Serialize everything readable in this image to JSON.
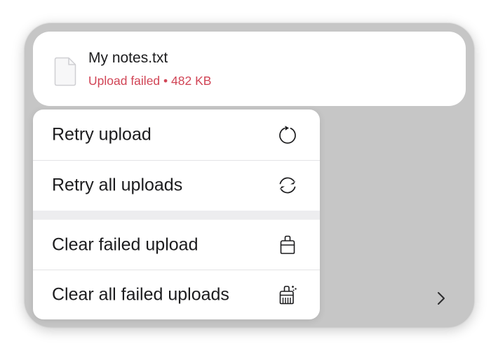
{
  "file": {
    "name": "My notes.txt",
    "status": "Upload failed • 482 KB",
    "icon": "document-icon"
  },
  "menu": {
    "items": [
      {
        "label": "Retry upload",
        "icon": "retry-arrow-icon"
      },
      {
        "label": "Retry all uploads",
        "icon": "retry-all-arrows-icon"
      },
      {
        "label": "Clear failed upload",
        "icon": "eraser-icon"
      },
      {
        "label": "Clear all failed uploads",
        "icon": "broom-sparkle-icon"
      }
    ]
  },
  "colors": {
    "error": "#d14556",
    "panel": "#c6c6c6",
    "text": "#1c1c1e"
  }
}
